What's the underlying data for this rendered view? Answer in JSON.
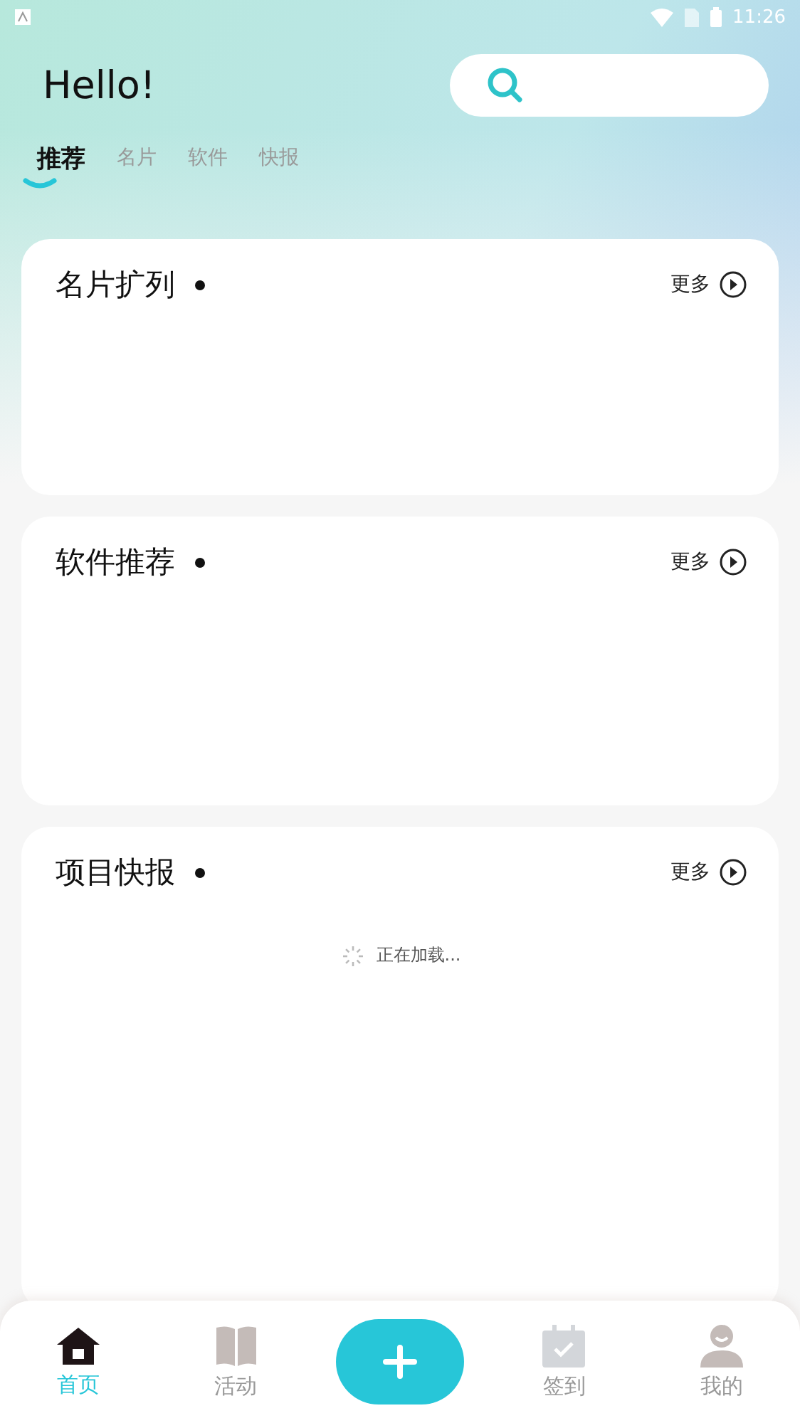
{
  "status_bar": {
    "time": "11:26"
  },
  "greeting": "Hello!",
  "tabs": [
    {
      "label": "推荐",
      "selected": true
    },
    {
      "label": "名片",
      "selected": false
    },
    {
      "label": "软件",
      "selected": false
    },
    {
      "label": "快报",
      "selected": false
    }
  ],
  "sections": [
    {
      "title": "名片扩列",
      "more": "更多"
    },
    {
      "title": "软件推荐",
      "more": "更多"
    },
    {
      "title": "项目快报",
      "more": "更多",
      "loading": "正在加载..."
    }
  ],
  "bottom_nav": [
    {
      "label": "首页",
      "selected": true
    },
    {
      "label": "活动",
      "selected": false
    },
    {
      "kind": "add"
    },
    {
      "label": "签到",
      "selected": false
    },
    {
      "label": "我的",
      "selected": false
    }
  ]
}
